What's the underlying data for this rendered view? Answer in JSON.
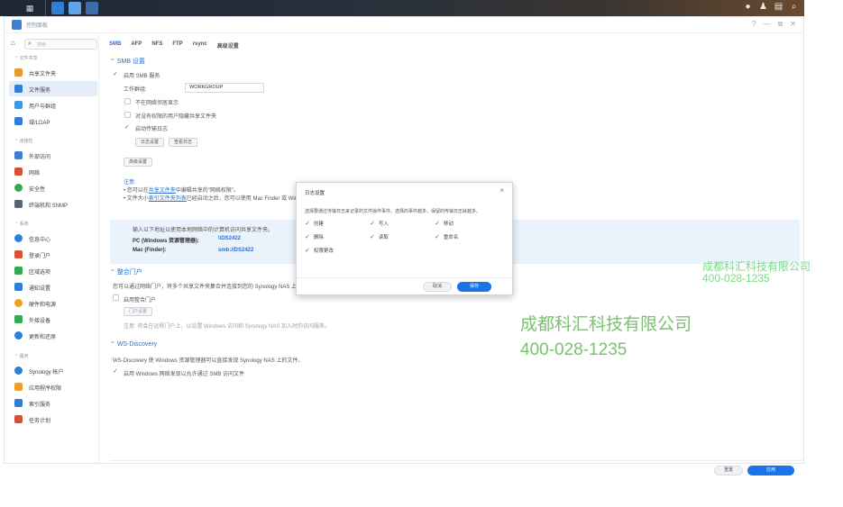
{
  "taskbar": {
    "icons": [
      "apps-grid-icon",
      "file-station-icon",
      "control-panel-icon",
      "package-icon"
    ],
    "right_icons": [
      "chat-icon",
      "user-icon",
      "widget-icon",
      "search-icon"
    ]
  },
  "window": {
    "title": "控制面板",
    "controls": [
      "?",
      "—",
      "⧉",
      "✕"
    ]
  },
  "sidebar": {
    "search_placeholder": "搜索",
    "groups": [
      {
        "label": "文件共享",
        "items": [
          {
            "label": "共享文件夹",
            "icon": "shared-folder-icon",
            "color": "#e89a2c"
          },
          {
            "label": "文件服务",
            "icon": "file-services-icon",
            "color": "#2f7fd8",
            "active": true
          },
          {
            "label": "用户与群组",
            "icon": "users-icon",
            "color": "#3d9be0"
          },
          {
            "label": "域/LDAP",
            "icon": "domain-icon",
            "color": "#2f7fd8"
          }
        ]
      },
      {
        "label": "连接性",
        "items": [
          {
            "label": "外部访问",
            "icon": "external-access-icon",
            "color": "#3d7fd6"
          },
          {
            "label": "网络",
            "icon": "network-icon",
            "color": "#d8503a"
          },
          {
            "label": "安全性",
            "icon": "security-icon",
            "color": "#35a853"
          },
          {
            "label": "终端机和 SNMP",
            "icon": "terminal-icon",
            "color": "#5a6470"
          }
        ]
      },
      {
        "label": "系统",
        "items": [
          {
            "label": "信息中心",
            "icon": "info-icon",
            "color": "#2f7fd8"
          },
          {
            "label": "登录门户",
            "icon": "login-portal-icon",
            "color": "#d8503a"
          },
          {
            "label": "区域选项",
            "icon": "regional-icon",
            "color": "#35a853"
          },
          {
            "label": "通知设置",
            "icon": "notification-icon",
            "color": "#2f7fd8"
          },
          {
            "label": "硬件和电源",
            "icon": "hardware-icon",
            "color": "#f0a020"
          },
          {
            "label": "外接设备",
            "icon": "external-devices-icon",
            "color": "#35a853"
          },
          {
            "label": "更新和还原",
            "icon": "update-icon",
            "color": "#2f7fd8"
          }
        ]
      },
      {
        "label": "服务",
        "items": [
          {
            "label": "Synology 帐户",
            "icon": "synology-account-icon",
            "color": "#2f7fd8"
          },
          {
            "label": "应用程序权限",
            "icon": "app-privileges-icon",
            "color": "#f0a020"
          },
          {
            "label": "索引服务",
            "icon": "indexing-icon",
            "color": "#2f7fd8"
          },
          {
            "label": "任务计划",
            "icon": "task-scheduler-icon",
            "color": "#d8503a"
          }
        ]
      }
    ]
  },
  "tabs": [
    {
      "label": "SMB",
      "active": true
    },
    {
      "label": "AFP"
    },
    {
      "label": "NFS"
    },
    {
      "label": "FTP"
    },
    {
      "label": "rsync"
    },
    {
      "label": "高级设置"
    }
  ],
  "smb": {
    "section_title": "SMB 设置",
    "enable_label": "启用 SMB 服务",
    "workgroup_label": "工作群组:",
    "workgroup_value": "WORKGROUP",
    "opt_hide_printers": "不在网络邻居显示",
    "opt_hide_no_permission": "对没有权限的用户隐藏共享文件夹",
    "opt_transfer_log": "启动传输日志",
    "btn_log_settings": "日志设置",
    "btn_view_logs": "查看日志",
    "btn_advanced": "高级设置",
    "note_title": "注意:",
    "note_line1_a": "• 您可以在",
    "note_line1_link": "共享文件夹",
    "note_line1_b": "中编辑共享的\"网络权限\"。",
    "note_line2_a": "• 文件大小",
    "note_line2_link": "索引文件夹列表",
    "note_line2_b": "已经启动之后，您可以使用 Mac Finder 或 Windows 搜索",
    "info_intro": "输入以下地址以使用本地网络中的计算机访问共享文件夹。",
    "pc_label": "PC (Windows 资源管理器):",
    "pc_value": "\\\\DS2422",
    "mac_label": "Mac (Finder):",
    "mac_value": "smb://DS2422"
  },
  "portal": {
    "section_title": "整合门户",
    "desc": "您可以通过网络门户，将多个共享文件夹集合并连接到您的 Synology NAS 上",
    "enable_label": "启用整合门户",
    "btn_settings": "门户设置",
    "note": "注意: 将会在远程门户上，以设置 Windows 访问和 Synology NAS 加入时的访问服务。"
  },
  "wsd": {
    "section_title": "WS-Discovery",
    "desc": "WS-Discovery 使 Windows 资源管理器可以直接发现 Synology NAS 上的文件。",
    "enable_label": "启用 Windows 网络发现以允许通过 SMB 访问文件"
  },
  "footer": {
    "reset": "重置",
    "apply": "应用"
  },
  "dialog": {
    "title": "日志设置",
    "desc": "选择要通过传输日志来记录的文件操作事件。选择的事件越多，保留的传输日志就越多。",
    "options": [
      {
        "label": "创建",
        "checked": true
      },
      {
        "label": "写入",
        "checked": true
      },
      {
        "label": "移动",
        "checked": true
      },
      {
        "label": "删除",
        "checked": true
      },
      {
        "label": "读取",
        "checked": true
      },
      {
        "label": "重命名",
        "checked": true
      },
      {
        "label": "权限更改",
        "checked": true
      }
    ],
    "cancel": "取消",
    "ok": "保存"
  },
  "watermark": {
    "company": "成都科汇科技有限公司",
    "phone": "400-028-1235"
  },
  "colors": {
    "accent": "#2a72d4",
    "primary_button": "#1a73e8",
    "watermark": "#7bc070"
  }
}
